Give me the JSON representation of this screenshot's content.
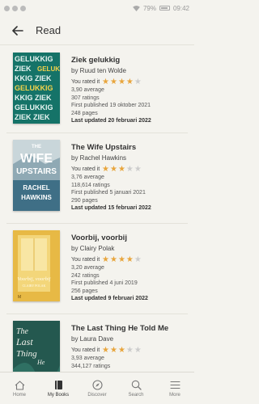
{
  "status": {
    "battery": "79%",
    "time": "09:42"
  },
  "header": {
    "title": "Read"
  },
  "books": [
    {
      "title": "Ziek gelukkig",
      "author": "by Ruud ten Wolde",
      "rated_label": "You rated it",
      "rating": 4,
      "average": "3,90 average",
      "ratings": "307 ratings",
      "published": "First published 19 oktober 2021",
      "pages": "248 pages",
      "updated": "Last updated 20 februari 2022",
      "cover": {
        "line1": "GELUKKIG",
        "line2": "ZIEK",
        "bg": "#1a7a70"
      }
    },
    {
      "title": "The Wife Upstairs",
      "author": "by Rachel Hawkins",
      "rated_label": "You rated it",
      "rating": 3,
      "average": "3,76 average",
      "ratings": "118,614 ratings",
      "published": "First published 5 januari 2021",
      "pages": "290 pages",
      "updated": "Last updated 15 februari 2022",
      "cover": {
        "line1": "THE WIFE UPSTAIRS",
        "line2": "RACHEL HAWKINS",
        "bg": "#2f5f78"
      }
    },
    {
      "title": "Voorbij, voorbij",
      "author": "by Clairy Polak",
      "rated_label": "You rated it",
      "rating": 4,
      "average": "3,20 average",
      "ratings": "242 ratings",
      "published": "First published 4 juni 2019",
      "pages": "256 pages",
      "updated": "Last updated 9 februari 2022",
      "cover": {
        "line1": "Voorbij, voorbij",
        "line2": "CLAIRY POLAK",
        "bg": "#e3b63f"
      }
    },
    {
      "title": "The Last Thing He Told Me",
      "author": "by Laura Dave",
      "rated_label": "You rated it",
      "rating": 3,
      "average": "3,93 average",
      "ratings": "344,127 ratings",
      "published": "",
      "pages": "",
      "updated": "",
      "cover": {
        "line1": "The Last Thing He Told Me",
        "line2": "",
        "bg": "#23574f"
      }
    }
  ],
  "nav": [
    {
      "label": "Home",
      "icon": "home-icon"
    },
    {
      "label": "My Books",
      "icon": "book-icon"
    },
    {
      "label": "Discover",
      "icon": "compass-icon"
    },
    {
      "label": "Search",
      "icon": "search-icon"
    },
    {
      "label": "More",
      "icon": "menu-icon"
    }
  ]
}
